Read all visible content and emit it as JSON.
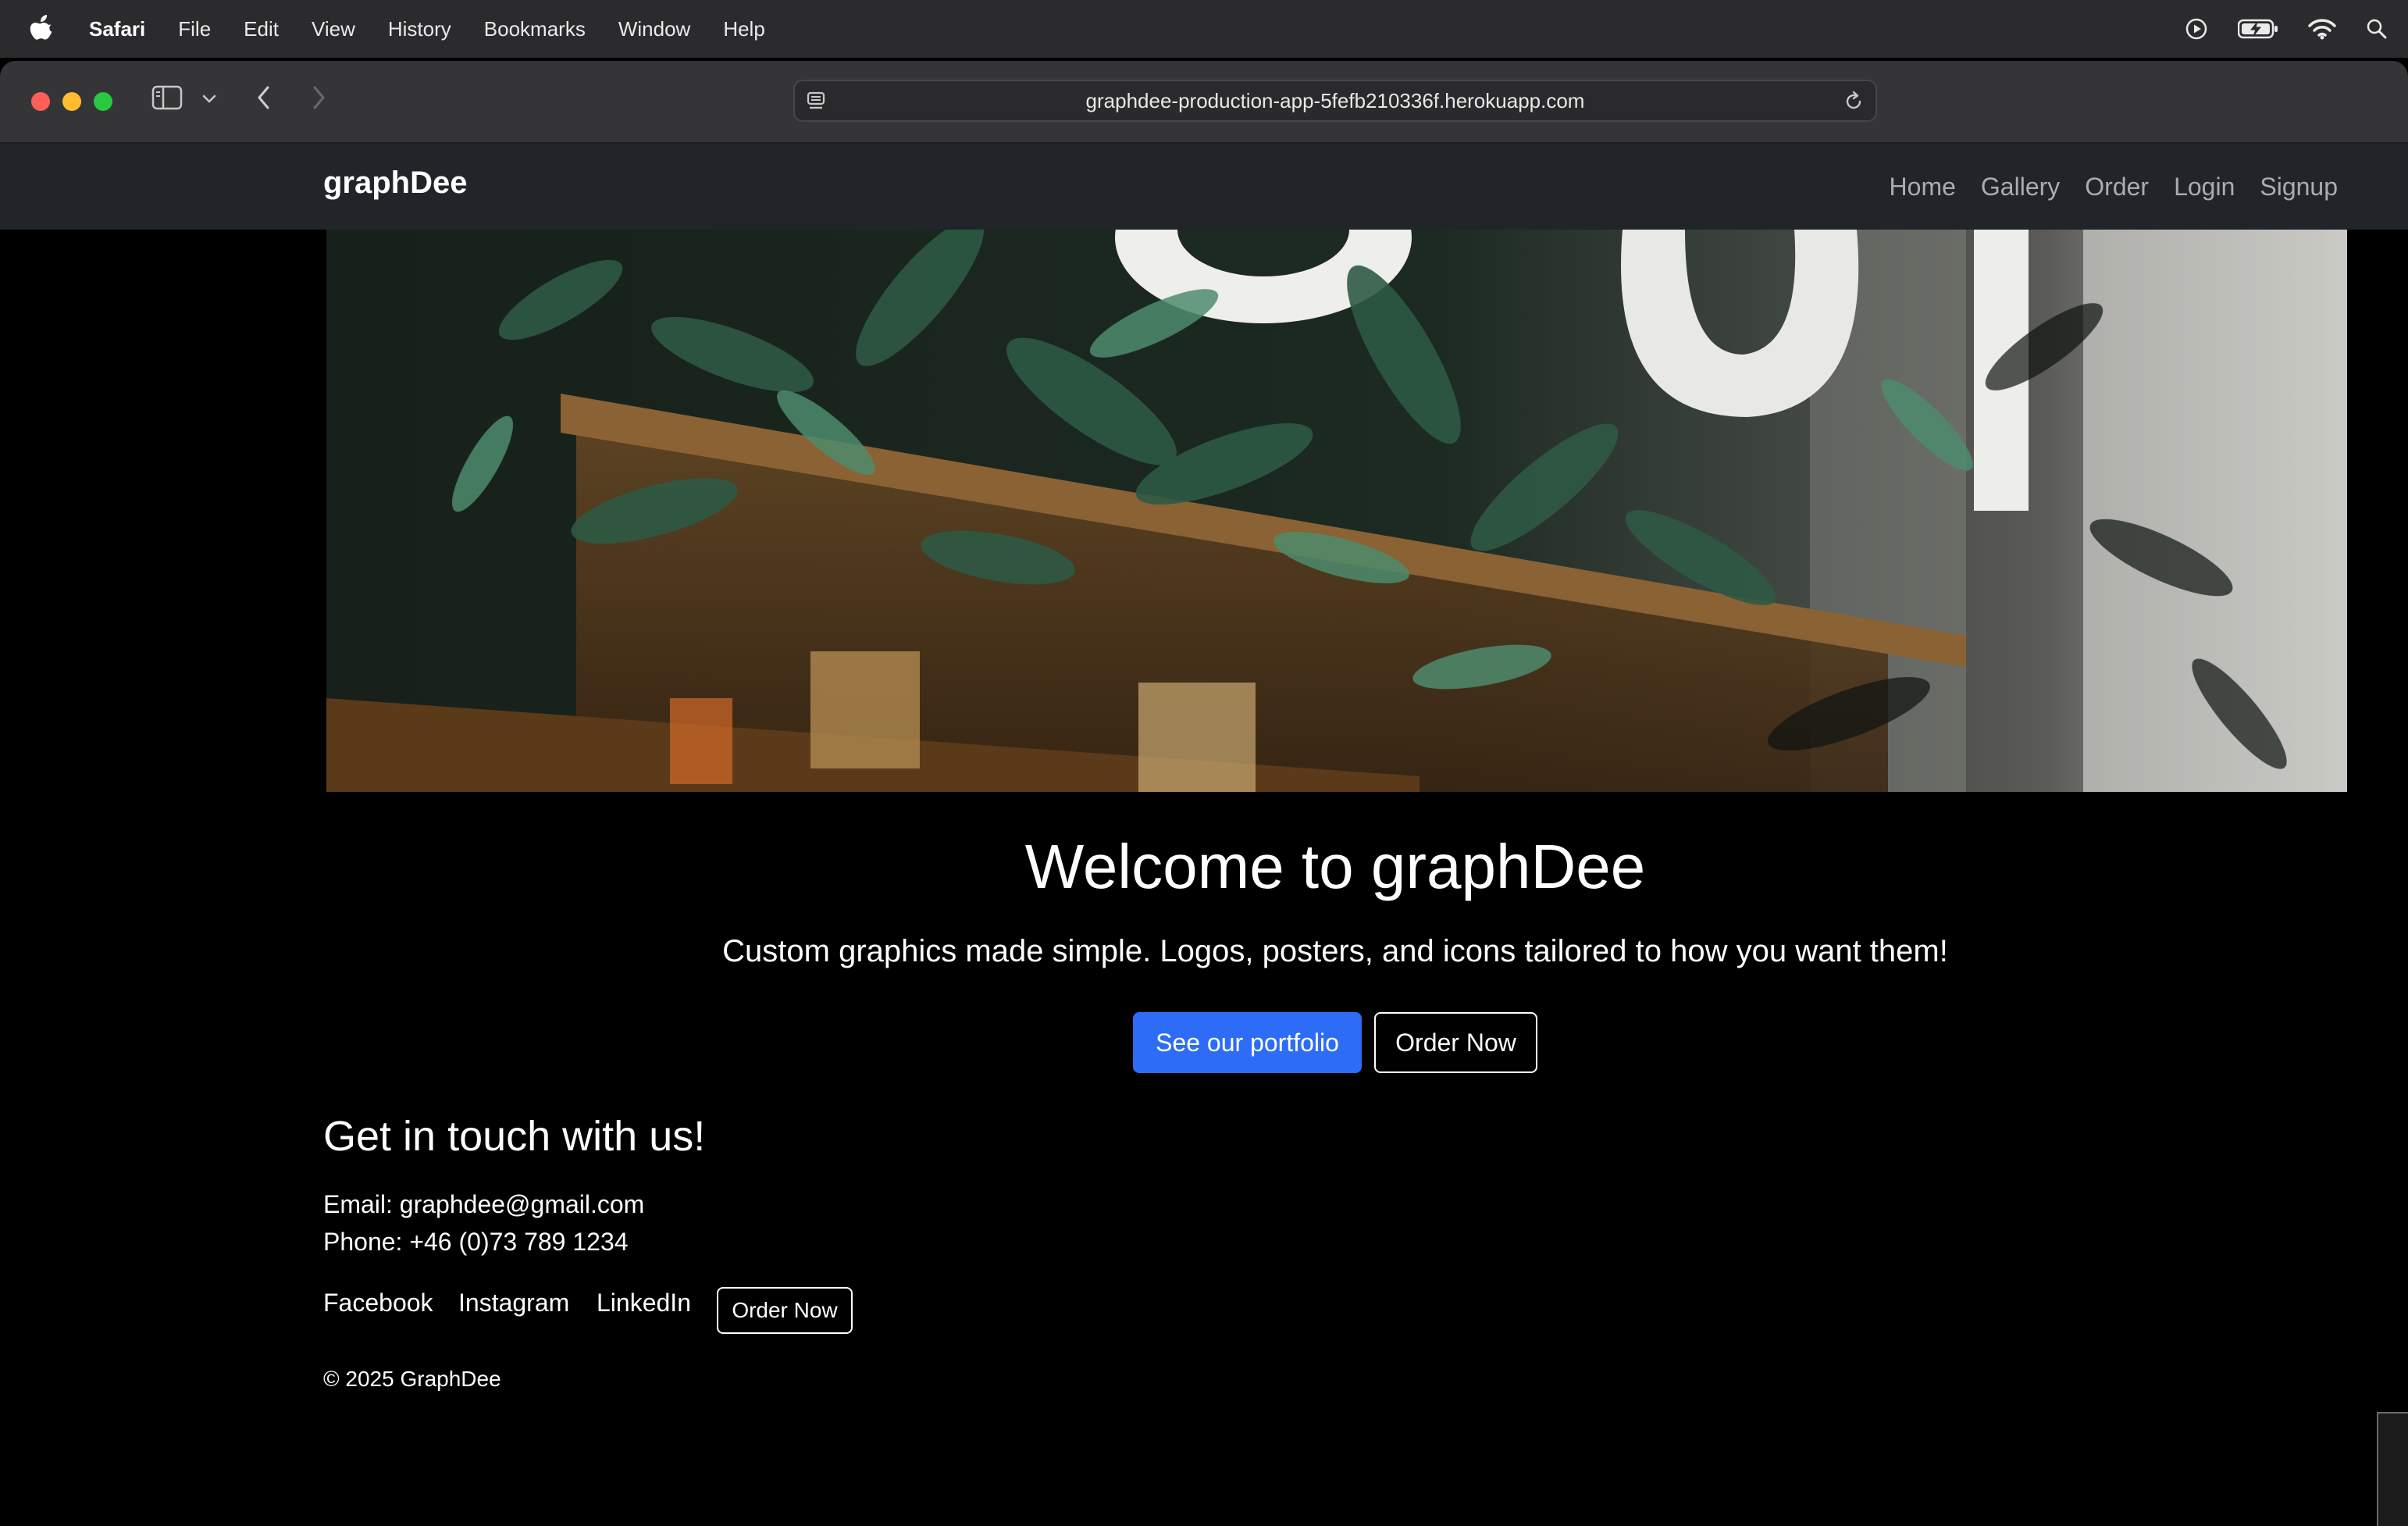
{
  "menubar": {
    "app": "Safari",
    "items": [
      "File",
      "Edit",
      "View",
      "History",
      "Bookmarks",
      "Window",
      "Help"
    ]
  },
  "browser": {
    "url": "graphdee-production-app-5fefb210336f.herokuapp.com"
  },
  "site": {
    "brand": "graphDee",
    "nav": [
      "Home",
      "Gallery",
      "Order",
      "Login",
      "Signup"
    ]
  },
  "hero": {
    "title": "Welcome to graphDee",
    "tagline": "Custom graphics made simple. Logos, posters, and icons tailored to how you want them!",
    "primary_button": "See our portfolio",
    "secondary_button": "Order Now"
  },
  "contact": {
    "title": "Get in touch with us!",
    "email": "Email: graphdee@gmail.com",
    "phone": "Phone: +46 (0)73 789 1234",
    "social": [
      "Facebook",
      "Instagram",
      "LinkedIn"
    ],
    "order_button": "Order Now"
  },
  "footer": {
    "copyright": "© 2025 GraphDee"
  },
  "colors": {
    "primary_button": "#2d6cf6",
    "navbar": "#212529",
    "page_bg": "#000000"
  }
}
